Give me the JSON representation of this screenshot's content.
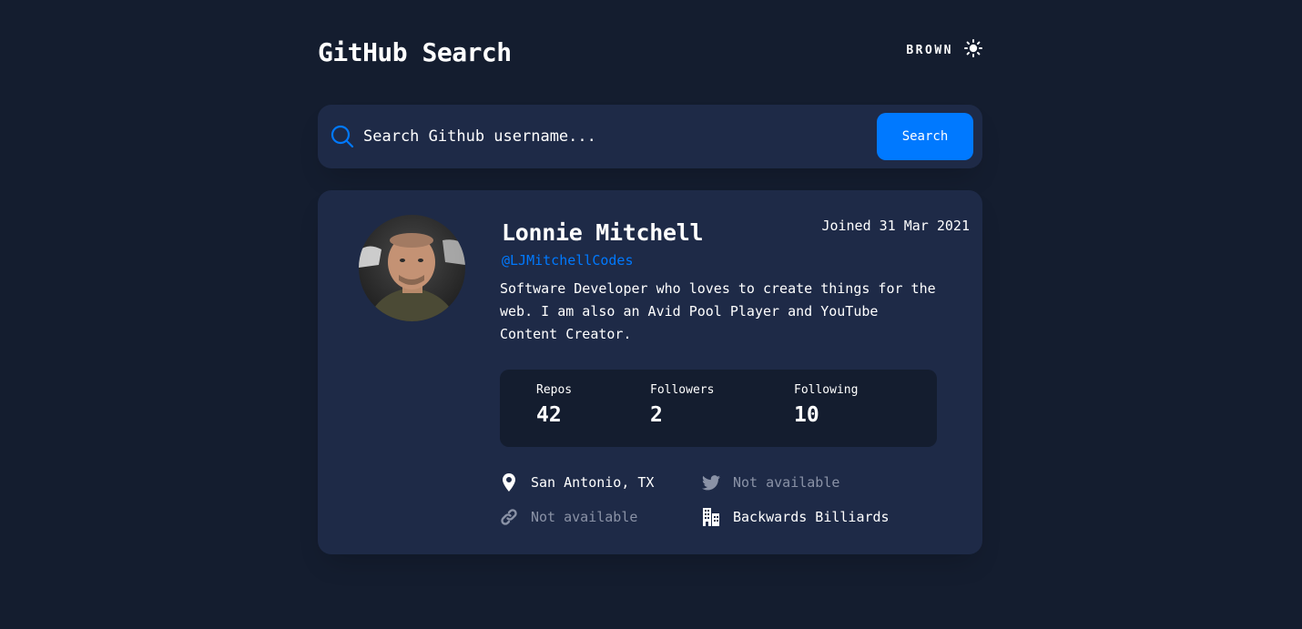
{
  "header": {
    "title": "GitHub Search",
    "theme_label": "BROWN",
    "theme_icon": "sun-icon"
  },
  "search": {
    "placeholder": "Search Github username...",
    "button_label": "Search",
    "icon": "search-icon"
  },
  "profile": {
    "avatar_alt": "Lonnie Mitchell avatar",
    "name": "Lonnie Mitchell",
    "login": "@LJMitchellCodes",
    "joined": "Joined 31 Mar 2021",
    "bio": "Software Developer who loves to create things for the web. I am also an Avid Pool Player and YouTube Content Creator.",
    "stats": {
      "repos_label": "Repos",
      "repos": "42",
      "followers_label": "Followers",
      "followers": "2",
      "following_label": "Following",
      "following": "10"
    },
    "links": {
      "location": "San Antonio, TX",
      "twitter": "Not available",
      "blog": "Not available",
      "company": "Backwards Billiards"
    }
  },
  "colors": {
    "background": "#141d2f",
    "card": "#1e2a47",
    "accent": "#0079ff",
    "muted": "#8a92a6"
  }
}
